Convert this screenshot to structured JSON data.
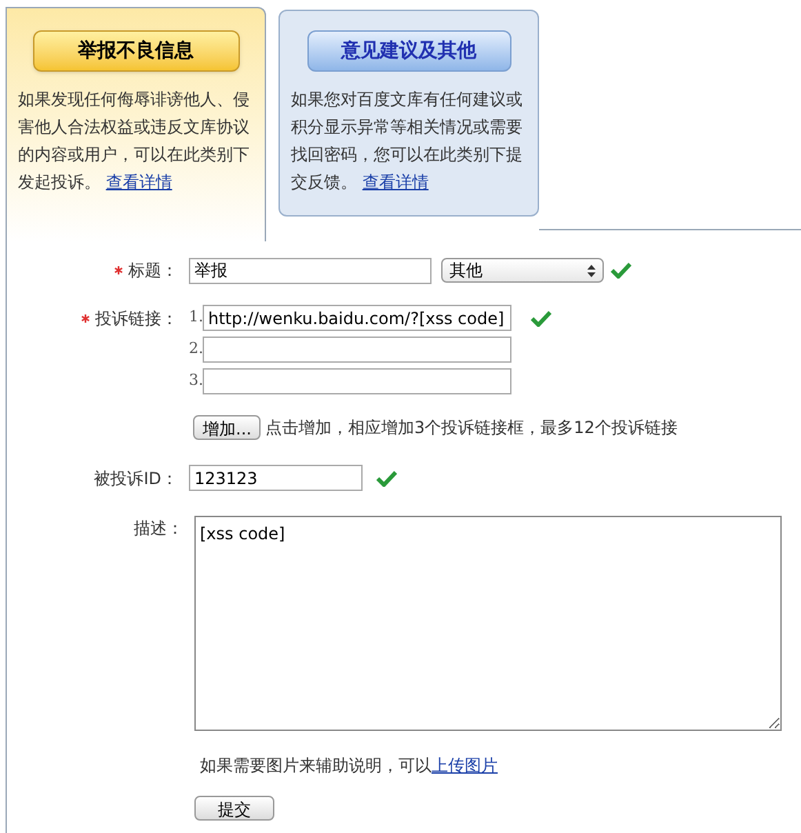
{
  "tabs": [
    {
      "title": "举报不良信息",
      "description": "如果发现任何侮辱诽谤他人、侵害他人合法权益或违反文库协议的内容或用户，可以在此类别下发起投诉。",
      "link": "查看详情",
      "selected": true
    },
    {
      "title": "意见建议及其他",
      "description": "如果您对百度文库有任何建议或积分显示异常等相关情况或需要找回密码，您可以在此类别下提交反馈。",
      "link": "查看详情",
      "selected": false
    }
  ],
  "form": {
    "title": {
      "label": "标题：",
      "required": true,
      "value": "举报",
      "select": "其他",
      "valid": true
    },
    "links": {
      "label": "投诉链接：",
      "required": true,
      "valid": true,
      "items": [
        {
          "number": "1.",
          "value": "http://wenku.baidu.com/?[xss code]"
        },
        {
          "number": "2."
        },
        {
          "number": "3."
        }
      ]
    },
    "add": {
      "button": "增加...",
      "hint": "点击增加，相应增加3个投诉链接框，最多12个投诉链接"
    },
    "id": {
      "label": "被投诉ID：",
      "value": "123123",
      "valid": true
    },
    "description": {
      "label": "描述：",
      "value": "[xss code]"
    },
    "upload": {
      "text": "如果需要图片来辅助说明，可以",
      "link": "上传图片"
    },
    "submit": "提交"
  }
}
